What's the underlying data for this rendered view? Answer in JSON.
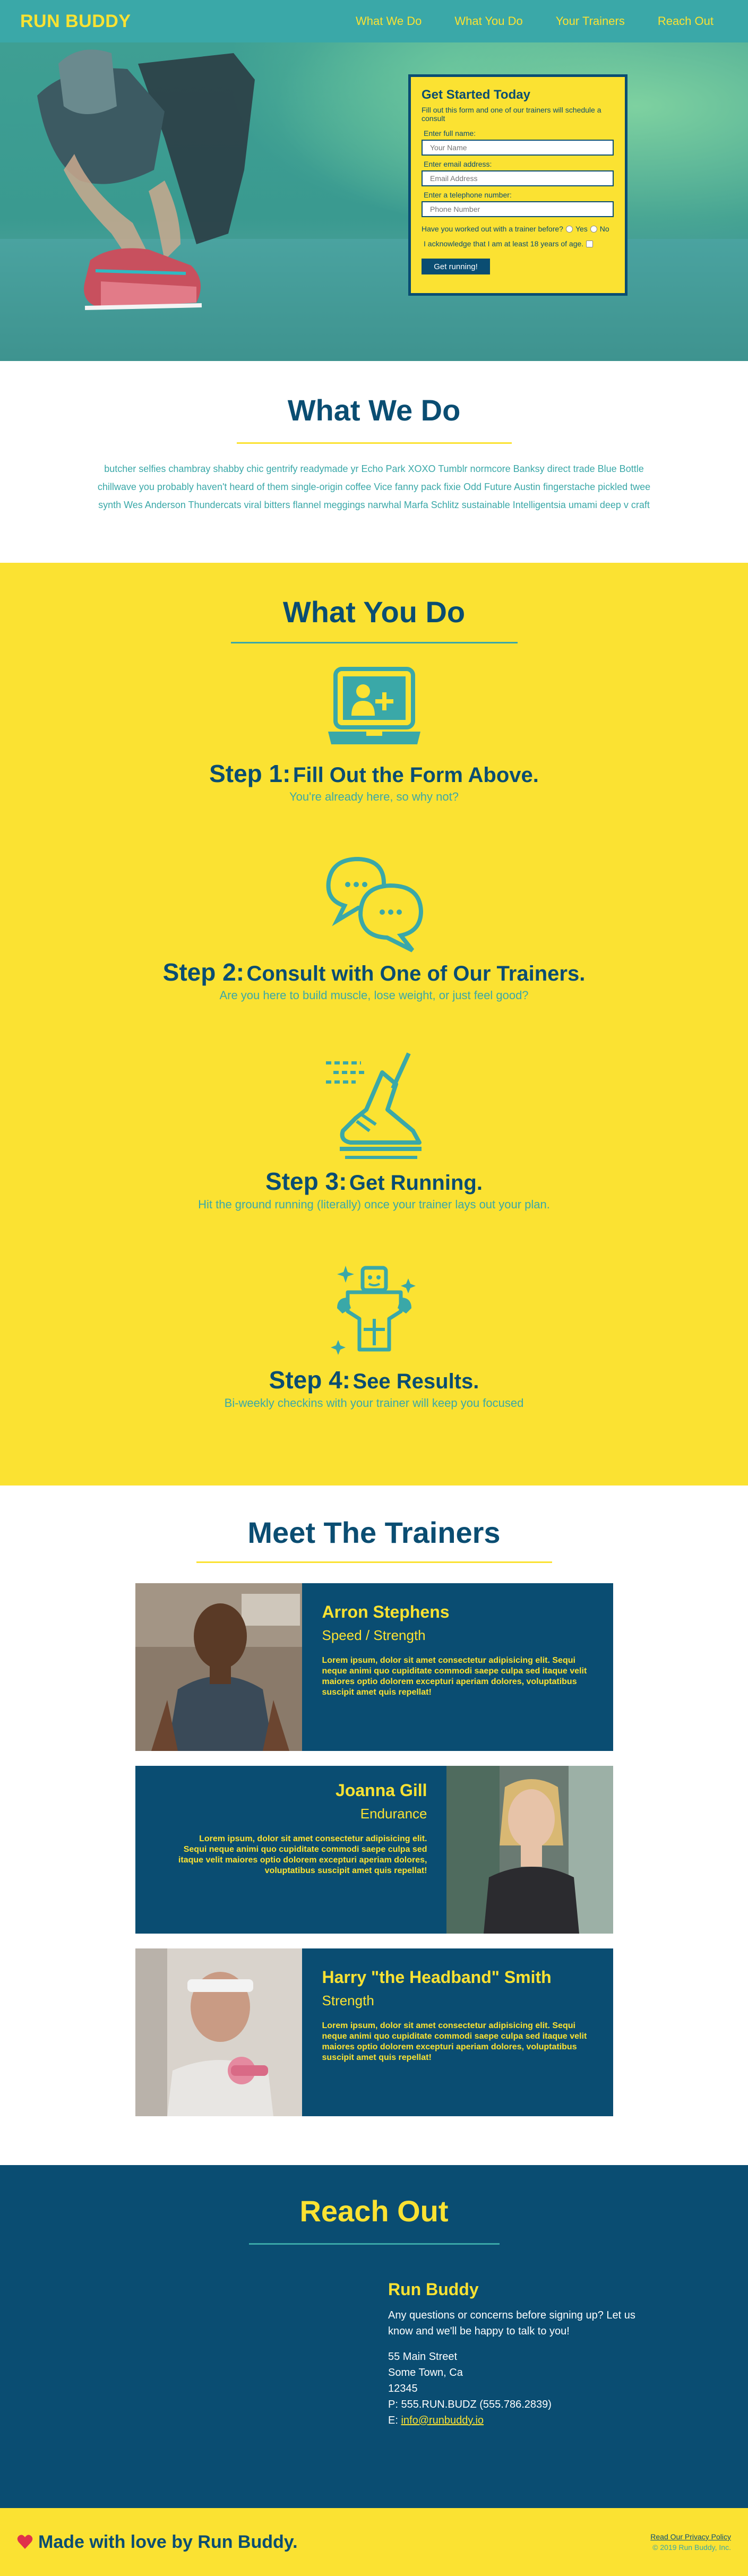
{
  "nav": {
    "brand": "RUN BUDDY",
    "links": [
      "What We Do",
      "What You Do",
      "Your Trainers",
      "Reach Out"
    ]
  },
  "hero_form": {
    "title": "Get Started Today",
    "subtitle": "Fill out this form and one of our trainers will schedule a consult",
    "name_label": "Enter full name:",
    "name_placeholder": "Your Name",
    "email_label": "Enter email address:",
    "email_placeholder": "Email Address",
    "phone_label": "Enter a telephone number:",
    "phone_placeholder": "Phone Number",
    "question": "Have you worked out with a trainer before?",
    "yes": "Yes",
    "no": "No",
    "age_check": "I acknowledge that I am at least 18 years of age.",
    "submit": "Get running!"
  },
  "what_we_do": {
    "title": "What We Do",
    "body": "butcher selfies chambray shabby chic gentrify readymade yr Echo Park XOXO Tumblr normcore Banksy direct trade Blue Bottle chillwave you probably haven't heard of them single-origin coffee Vice fanny pack fixie Odd Future Austin fingerstache pickled twee synth Wes Anderson Thundercats viral bitters flannel meggings narwhal Marfa Schlitz sustainable Intelligentsia umami deep v craft"
  },
  "what_you_do": {
    "title": "What You Do",
    "steps": [
      {
        "num": "Step 1:",
        "title": "Fill Out the Form Above.",
        "text": "You're already here, so why not?",
        "icon": "laptop-add-user-icon"
      },
      {
        "num": "Step 2:",
        "title": "Consult with One of Our Trainers.",
        "text": "Are you here to build muscle, lose weight, or just feel good?",
        "icon": "chat-bubbles-icon"
      },
      {
        "num": "Step 3:",
        "title": "Get Running.",
        "text": "Hit the ground running (literally) once your trainer lays out your plan.",
        "icon": "running-shoe-icon"
      },
      {
        "num": "Step 4:",
        "title": "See Results.",
        "text": "Bi-weekly checkins with your trainer will keep you focused",
        "icon": "strong-man-icon"
      }
    ]
  },
  "trainers": {
    "title": "Meet The Trainers",
    "list": [
      {
        "name": "Arron Stephens",
        "specialty": "Speed / Strength",
        "bio": "Lorem ipsum, dolor sit amet consectetur adipisicing elit. Sequi neque animi quo cupiditate commodi saepe culpa sed itaque velit maiores optio dolorem excepturi aperiam dolores, voluptatibus suscipit amet quis repellat!"
      },
      {
        "name": "Joanna Gill",
        "specialty": "Endurance",
        "bio": "Lorem ipsum, dolor sit amet consectetur adipisicing elit. Sequi neque animi quo cupiditate commodi saepe culpa sed itaque velit maiores optio dolorem excepturi aperiam dolores, voluptatibus suscipit amet quis repellat!"
      },
      {
        "name": "Harry \"the Headband\" Smith",
        "specialty": "Strength",
        "bio": "Lorem ipsum, dolor sit amet consectetur adipisicing elit. Sequi neque animi quo cupiditate commodi saepe culpa sed itaque velit maiores optio dolorem excepturi aperiam dolores, voluptatibus suscipit amet quis repellat!"
      }
    ]
  },
  "reach_out": {
    "title": "Reach Out",
    "company": "Run Buddy",
    "message": "Any questions or concerns before signing up? Let us know and we'll be happy to talk to you!",
    "street": "55 Main Street",
    "city": "Some Town, Ca",
    "zip": "12345",
    "phone": "P: 555.RUN.BUDZ (555.786.2839)",
    "email_prefix": "E: ",
    "email": "info@runbuddy.io"
  },
  "footer": {
    "made": "Made with love by Run Buddy.",
    "privacy": "Read Our Privacy Policy",
    "copyright": "© 2019 Run Buddy, Inc."
  },
  "colors": {
    "teal": "#3aa8a8",
    "navy": "#0a4d72",
    "yellow": "#fbe232"
  }
}
